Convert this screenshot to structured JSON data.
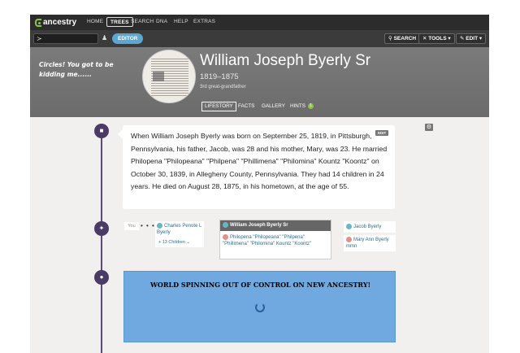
{
  "nav": {
    "logo": "ancestry",
    "links": [
      "HOME",
      "TREES",
      "SEARCH",
      "DNA",
      "HELP",
      "EXTRAS"
    ]
  },
  "toolbar": {
    "editor": "EDITOR",
    "search": "SEARCH",
    "tools": "TOOLS",
    "edit": "EDIT"
  },
  "annotation": "Circles! You got to be kidding me......",
  "person": {
    "name": "William Joseph Byerly Sr",
    "lifespan": "1819–1875",
    "relationship": "3rd great-grandfather"
  },
  "tabs": [
    "LIFESTORY",
    "FACTS",
    "GALLERY",
    "HINTS"
  ],
  "hints_count": "1",
  "lifestory": {
    "text": "When William Joseph Byerly was born on September 25, 1819, in Pittsburgh, Pennsylvania, his father, Jacob, was 28 and his mother, Mary, was 23. He married Philopena \"Philopeana\" \"Philpena\" \"Phillimena\" \"Philomina\" Kountz \"Koontz\" on October 30, 1839, in Allegheny County, Pennsylvania. They had 14 children in 24 years. He died on August 28, 1875, in his hometown, at the age of 55.",
    "edit_label": "EDIT"
  },
  "family": {
    "you_label": "You",
    "dots": "• • •",
    "child": "Charles Penote L Byerly",
    "children_count": "+ 13 Children",
    "focus": "William Joseph Byerly Sr",
    "spouse": "Philopena \"Philopeana\" \"Philpena\" \"Phillimena\" \"Philomina\" Kountz \"Koontz\"",
    "father": "Jacob Byerly",
    "mother": "Mary Ann Byerly mmn"
  },
  "overlay": {
    "text": "WORLD SPINNING OUT OF CONTROL ON NEW ANCESTRY!"
  },
  "colors": {
    "timeline": "#4a3a66",
    "overlay": "#6fa9e0",
    "editor_badge": "#5aa7d1",
    "hints_badge": "#8cc63f"
  }
}
